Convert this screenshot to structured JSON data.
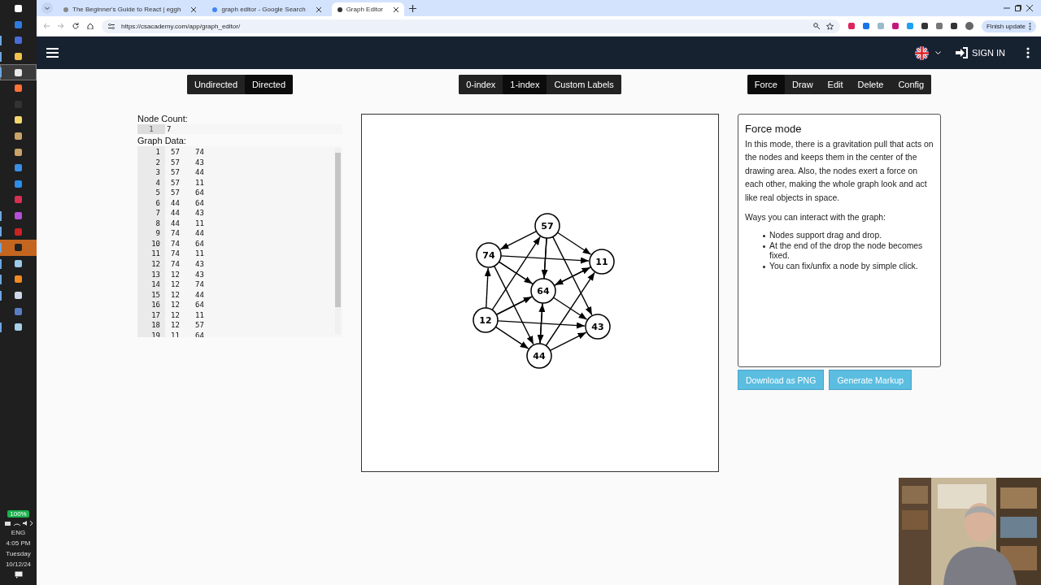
{
  "taskbar": {
    "apps": [
      {
        "running": false,
        "selected": false,
        "flashing": false
      },
      {
        "running": false,
        "selected": false,
        "flashing": false
      },
      {
        "running": true,
        "selected": false,
        "flashing": false
      },
      {
        "running": true,
        "selected": false,
        "flashing": false
      },
      {
        "running": true,
        "selected": true,
        "flashing": false
      },
      {
        "running": false,
        "selected": false,
        "flashing": false
      },
      {
        "running": false,
        "selected": false,
        "flashing": false
      },
      {
        "running": false,
        "selected": false,
        "flashing": false
      },
      {
        "running": false,
        "selected": false,
        "flashing": false
      },
      {
        "running": false,
        "selected": false,
        "flashing": false
      },
      {
        "running": false,
        "selected": false,
        "flashing": false
      },
      {
        "running": false,
        "selected": false,
        "flashing": false
      },
      {
        "running": false,
        "selected": false,
        "flashing": false
      },
      {
        "running": true,
        "selected": false,
        "flashing": false
      },
      {
        "running": true,
        "selected": false,
        "flashing": false
      },
      {
        "running": true,
        "selected": false,
        "flashing": true
      },
      {
        "running": true,
        "selected": false,
        "flashing": false
      },
      {
        "running": true,
        "selected": false,
        "flashing": false
      },
      {
        "running": true,
        "selected": false,
        "flashing": false
      },
      {
        "running": false,
        "selected": false,
        "flashing": false
      },
      {
        "running": true,
        "selected": false,
        "flashing": false
      }
    ],
    "tray": {
      "battery": "100%",
      "language": "ENG",
      "time": "4:05 PM",
      "day": "Tuesday",
      "date": "10/12/24"
    }
  },
  "browser": {
    "tabs": [
      {
        "title": "The Beginner's Guide to React | eggh",
        "selected": false
      },
      {
        "title": "graph editor - Google Search",
        "selected": false
      },
      {
        "title": "Graph Editor",
        "selected": true
      }
    ],
    "url": "https://csacademy.com/app/graph_editor/",
    "update_button": "Finish update"
  },
  "navbar": {
    "sign_in": "SIGN IN"
  },
  "toolbars": {
    "edge_type": [
      {
        "label": "Undirected",
        "selected": false
      },
      {
        "label": "Directed",
        "selected": true
      }
    ],
    "indexing": [
      {
        "label": "0-index",
        "selected": false
      },
      {
        "label": "1-index",
        "selected": true
      },
      {
        "label": "Custom Labels",
        "selected": false
      }
    ],
    "modes": [
      {
        "label": "Force",
        "selected": true
      },
      {
        "label": "Draw",
        "selected": false
      },
      {
        "label": "Edit",
        "selected": false
      },
      {
        "label": "Delete",
        "selected": false
      },
      {
        "label": "Config",
        "selected": false
      }
    ]
  },
  "node_count": {
    "label": "Node Count:",
    "line": "1",
    "value": "7"
  },
  "graph_data": {
    "label": "Graph Data:",
    "rows": [
      {
        "line": "1",
        "from": "57",
        "to": "74"
      },
      {
        "line": "2",
        "from": "57",
        "to": "43"
      },
      {
        "line": "3",
        "from": "57",
        "to": "44"
      },
      {
        "line": "4",
        "from": "57",
        "to": "11"
      },
      {
        "line": "5",
        "from": "57",
        "to": "64"
      },
      {
        "line": "6",
        "from": "44",
        "to": "64"
      },
      {
        "line": "7",
        "from": "44",
        "to": "43"
      },
      {
        "line": "8",
        "from": "44",
        "to": "11"
      },
      {
        "line": "9",
        "from": "74",
        "to": "44"
      },
      {
        "line": "10",
        "from": "74",
        "to": "64"
      },
      {
        "line": "11",
        "from": "74",
        "to": "11"
      },
      {
        "line": "12",
        "from": "74",
        "to": "43"
      },
      {
        "line": "13",
        "from": "12",
        "to": "43"
      },
      {
        "line": "14",
        "from": "12",
        "to": "74"
      },
      {
        "line": "15",
        "from": "12",
        "to": "44"
      },
      {
        "line": "16",
        "from": "12",
        "to": "64"
      },
      {
        "line": "17",
        "from": "12",
        "to": "11"
      },
      {
        "line": "18",
        "from": "12",
        "to": "57"
      },
      {
        "line": "19",
        "from": "11",
        "to": "64"
      }
    ]
  },
  "graph": {
    "nodes": [
      {
        "label": "57"
      },
      {
        "label": "74"
      },
      {
        "label": "11"
      },
      {
        "label": "64"
      },
      {
        "label": "12"
      },
      {
        "label": "43"
      },
      {
        "label": "44"
      }
    ]
  },
  "info": {
    "title": "Force mode",
    "paragraph": "In this mode, there is a gravitation pull that acts on the nodes and keeps them in the center of the drawing area. Also, the nodes exert a force on each other, making the whole graph look and act like real objects in space.",
    "subtitle": "Ways you can interact with the graph:",
    "bullets": [
      "Nodes support drag and drop.",
      "At the end of the drop the node becomes fixed.",
      "You can fix/unfix a node by simple click."
    ]
  },
  "actions": [
    "Download as PNG",
    "Generate Markup"
  ],
  "webcam": {
    "kind": "picture"
  }
}
